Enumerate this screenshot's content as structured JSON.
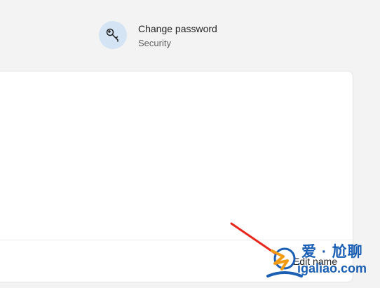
{
  "change_password": {
    "title": "Change password",
    "subtitle": "Security",
    "icon": "key-icon"
  },
  "card": {
    "edit_name_label": "Edit name"
  },
  "watermark": {
    "chinese": "爱 · 尬聊",
    "domain": "igaliao.com"
  },
  "colors": {
    "background": "#f3f3f3",
    "card": "#ffffff",
    "icon_circle": "#d4e4f4",
    "icon_stroke": "#1f1f1f",
    "arrow": "#e8261c",
    "watermark_blue": "#1a5fb4",
    "watermark_orange": "#f39c12"
  }
}
